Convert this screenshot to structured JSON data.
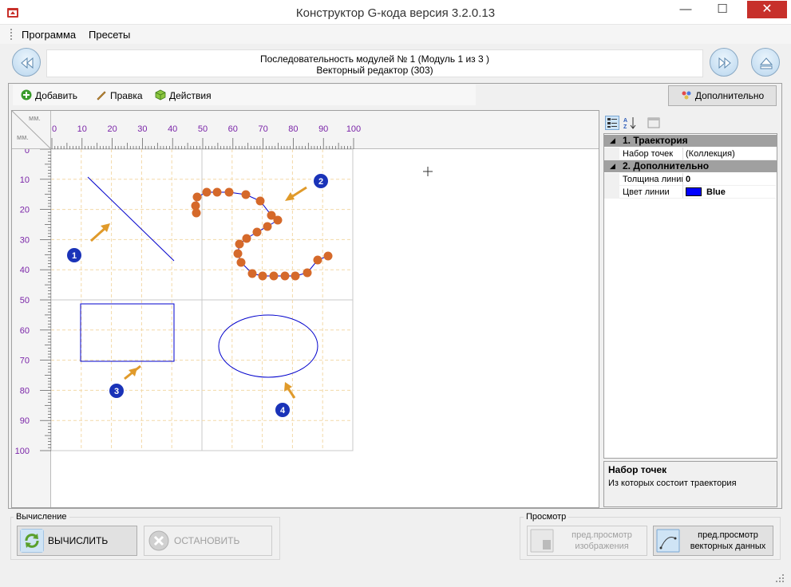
{
  "window": {
    "title": "Конструктор G-кода версия 3.2.0.13"
  },
  "menu": {
    "items": [
      "Программа",
      "Пресеты"
    ]
  },
  "sequence": {
    "line1": "Последовательность модулей № 1 (Модуль 1 из 3 )",
    "line2": "Векторный редактор (303)"
  },
  "toolbar": {
    "add_label": "Добавить",
    "edit_label": "Правка",
    "actions_label": "Действия",
    "more_label": "Дополнительно"
  },
  "ruler": {
    "corner_top": "мм.",
    "corner_bottom": "мм.",
    "x_labels": [
      "0",
      "10",
      "20",
      "30",
      "40",
      "50",
      "60",
      "70",
      "80",
      "90",
      "100"
    ],
    "y_labels": [
      "0",
      "10",
      "20",
      "30",
      "40",
      "50",
      "60",
      "70",
      "80",
      "90",
      "100"
    ]
  },
  "markers": [
    "1",
    "2",
    "3",
    "4"
  ],
  "properties": {
    "cat1": "1. Траектория",
    "prop1_name": "Набор точек",
    "prop1_value": "(Коллекция)",
    "cat2": "2. Дополнительно",
    "prop2_name": "Толщина линии",
    "prop2_value": "0",
    "prop3_name": "Цвет линии",
    "prop3_value": "Blue",
    "line_color": "#0000ff",
    "desc_title": "Набор точек",
    "desc_text": "Из которых состоит траектория"
  },
  "calc_group": {
    "label": "Вычисление",
    "calc_button": "ВЫЧИСЛИТЬ",
    "stop_button": "ОСТАНОВИТЬ"
  },
  "preview_group": {
    "label": "Просмотр",
    "image_preview_line1": "пред.просмотр",
    "image_preview_line2": "изображения",
    "vector_preview_line1": "пред.просмотр",
    "vector_preview_line2": "векторных данных"
  },
  "colors": {
    "ruler_text": "#7a24a8",
    "shape": "#0000cc",
    "point": "#d5692a",
    "marker": "#1a33b8"
  }
}
